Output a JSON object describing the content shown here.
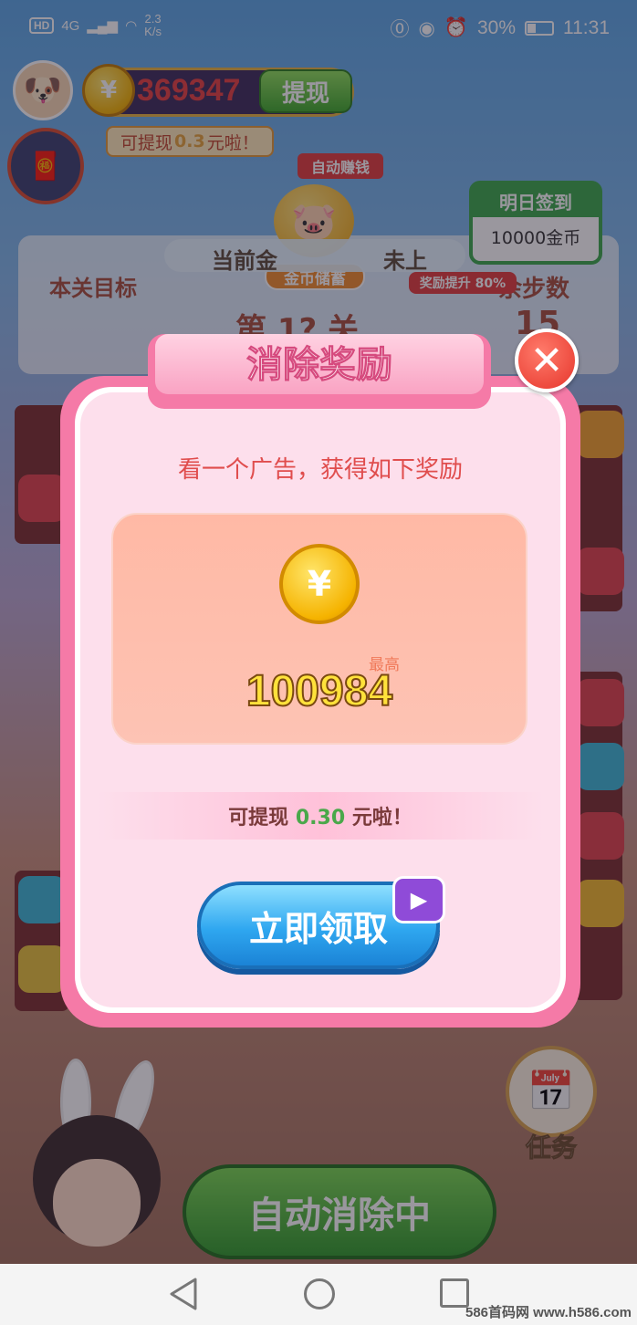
{
  "status_bar": {
    "hd": "HD",
    "signal": "4G",
    "speed_value": "2.3",
    "speed_unit": "K/s",
    "battery": "30%",
    "time": "11:31"
  },
  "header": {
    "coins": "369347",
    "withdraw_label": "提现",
    "withdraw_tip_prefix": "可提现",
    "withdraw_tip_amount": "0.3",
    "withdraw_tip_suffix": "元啦！",
    "auto_earn_label": "自动赚钱",
    "piggy_label": "金币储蓄",
    "signin_title": "明日签到",
    "signin_reward": "10000金币"
  },
  "level_panel": {
    "goal_label": "本关目标",
    "steps_label": "余步数",
    "bonus_text_left": "当前金",
    "bonus_text_right": "未上",
    "boost_tag": "奖励提升 80%",
    "level_text": "第 1? 关",
    "steps_value": "15"
  },
  "modal": {
    "title": "消除奖励",
    "close_symbol": "✕",
    "subtitle": "看一个广告，获得如下奖励",
    "max_label": "最高",
    "reward_amount": "100984",
    "cash_prefix": "可提现",
    "cash_amount": "0.30",
    "cash_suffix": "元啦！",
    "claim_label": "立即领取"
  },
  "bottom": {
    "task_label": "任务",
    "auto_clear_label": "自动消除中"
  },
  "watermark": "586首码网 www.h586.com",
  "colors": {
    "modal_border": "#f57aa7",
    "modal_body": "#fddfec",
    "claim_button": "#2fa7f0",
    "reward_amount": "#ffe23b",
    "cash_amount": "#4aa84a"
  }
}
